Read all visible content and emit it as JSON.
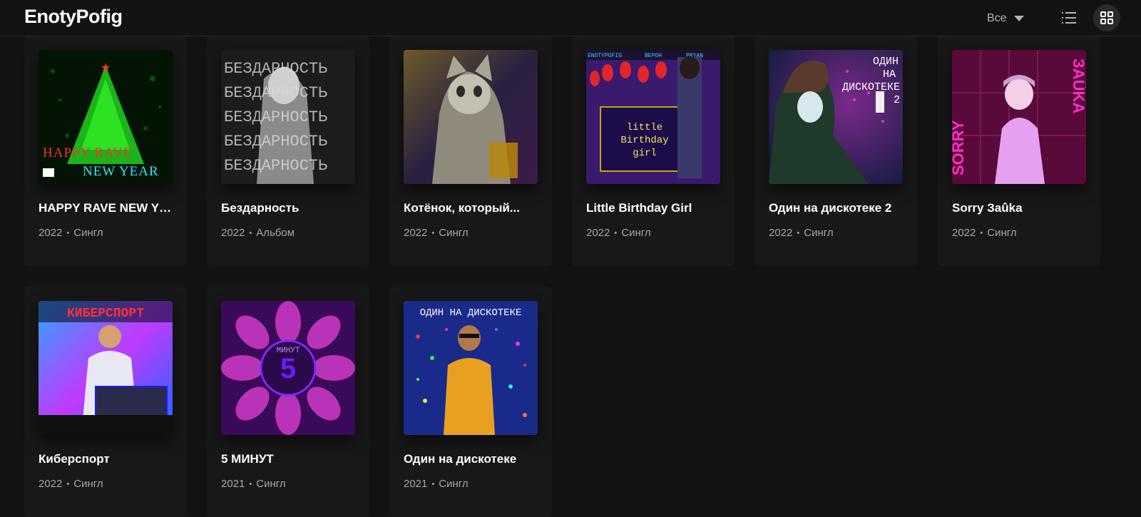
{
  "header": {
    "artist_name": "EnotyPofig",
    "filter_label": "Все",
    "list_view_icon": "list-icon",
    "grid_view_icon": "grid-icon"
  },
  "releases": [
    {
      "title": "HAPPY RAVE NEW YEAR",
      "year": "2022",
      "type": "Сингл"
    },
    {
      "title": "Бездарность",
      "year": "2022",
      "type": "Альбом"
    },
    {
      "title": "Котёнок, который...",
      "year": "2022",
      "type": "Сингл"
    },
    {
      "title": "Little Birthday Girl",
      "year": "2022",
      "type": "Сингл"
    },
    {
      "title": "Один на дискотеке 2",
      "year": "2022",
      "type": "Сингл"
    },
    {
      "title": "Sorry Заûka",
      "year": "2022",
      "type": "Сингл"
    },
    {
      "title": "Киберспорт",
      "year": "2022",
      "type": "Сингл"
    },
    {
      "title": "5 МИНУТ",
      "year": "2021",
      "type": "Сингл"
    },
    {
      "title": "Один на дискотеке",
      "year": "2021",
      "type": "Сингл"
    }
  ],
  "cover_text": {
    "c0": [
      "HAPPY RAVE",
      "NEW YEAR"
    ],
    "c1": [
      "БЕЗДАРНОСТЬ",
      "БЕЗДАРНОСТЬ",
      "БЕЗДАРНОСТЬ",
      "БЕЗДАРНОСТЬ",
      "БЕЗДАРНОСТЬ"
    ],
    "c3": [
      "ENOTYPOFIG",
      "ВЕРОН",
      "PRYAN",
      "little",
      "Birthday",
      "girl"
    ],
    "c4": [
      "ОДИН",
      "НА",
      "ДИСКОТЕКЕ",
      "2"
    ],
    "c5": [
      "SORRY",
      "ЗАÛKA"
    ],
    "c6": [
      "КИБЕРСПОРТ"
    ],
    "c7": [
      "5",
      "МИНУТ"
    ],
    "c8": [
      "ОДИН НА ДИСКОТЕКЕ"
    ]
  }
}
